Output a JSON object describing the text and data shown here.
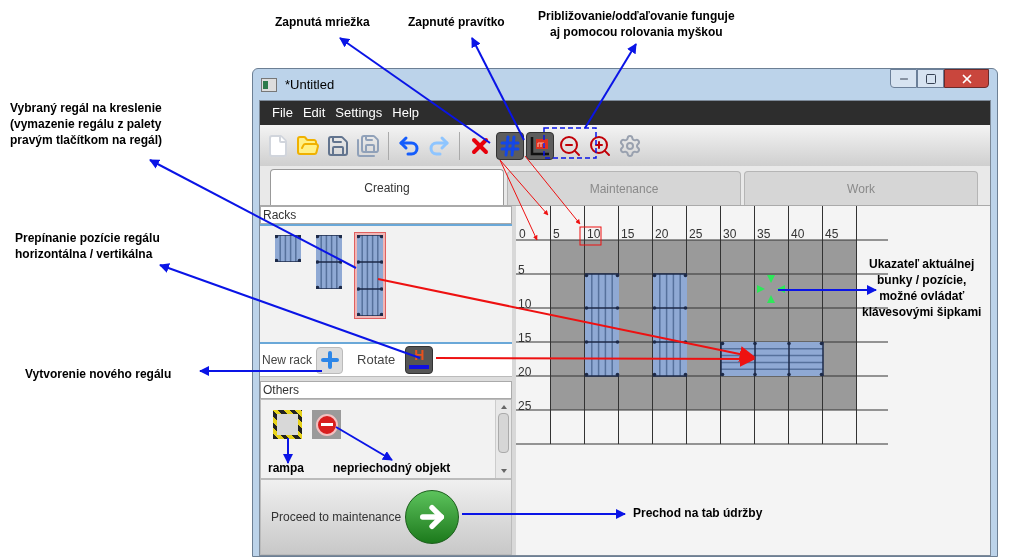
{
  "annotations": [
    {
      "text": "Zapnutá mriežka"
    },
    {
      "text": "Zapnuté pravítko"
    },
    {
      "text": "Približovanie/odďaľovanie funguje\naj pomocou rolovania myškou"
    },
    {
      "text": "Vybraný regál na kreslenie\n(vymazenie regálu z palety\npravým tlačítkom na regál)"
    },
    {
      "text": "Prepínanie pozície regálu\nhorizontálna / vertikálna"
    },
    {
      "text": "Vytvorenie nového regálu"
    },
    {
      "text": "Ukazateľ aktuálnej\nbunky / pozície,\nmožné ovládať\nklávesovými šipkami"
    },
    {
      "text": "rampa"
    },
    {
      "text": "nepriechodný objekt"
    },
    {
      "text": "Prechod na tab údržby"
    }
  ],
  "window": {
    "title": "*Untitled"
  },
  "menu": [
    "File",
    "Edit",
    "Settings",
    "Help"
  ],
  "toolbar": [
    {
      "kind": "new",
      "on": false
    },
    {
      "kind": "open",
      "on": false
    },
    {
      "kind": "save",
      "on": false
    },
    {
      "kind": "save-all",
      "on": false
    },
    {
      "kind": "undo",
      "on": false
    },
    {
      "kind": "redo",
      "on": false
    },
    {
      "kind": "delete",
      "on": false
    },
    {
      "kind": "grid",
      "on": true
    },
    {
      "kind": "ruler",
      "on": true
    },
    {
      "kind": "zoom-out",
      "on": false
    },
    {
      "kind": "zoom-in",
      "on": false
    },
    {
      "kind": "settings",
      "on": false
    }
  ],
  "tabs": [
    {
      "label": "Creating",
      "selected": true
    },
    {
      "label": "Maintenance",
      "selected": false
    },
    {
      "label": "Work",
      "selected": false
    }
  ],
  "racks_panel": {
    "title": "Racks",
    "palette": [
      {
        "kind": "single",
        "selected": false
      },
      {
        "kind": "double",
        "selected": false
      },
      {
        "kind": "triple",
        "selected": true
      }
    ],
    "new_rack_label": "New rack",
    "rotate_label": "Rotate",
    "rotate_button": "H"
  },
  "others_panel": {
    "title": "Others",
    "items": [
      {
        "kind": "ramp"
      },
      {
        "kind": "blocked"
      }
    ]
  },
  "proceed_button": {
    "label": "Proceed to maintenance"
  },
  "canvas": {
    "column_labels": [
      "0",
      "5",
      "10",
      "15",
      "20",
      "25",
      "30",
      "35",
      "40",
      "45"
    ],
    "row_labels": [
      "5",
      "10",
      "15",
      "20",
      "25"
    ]
  }
}
